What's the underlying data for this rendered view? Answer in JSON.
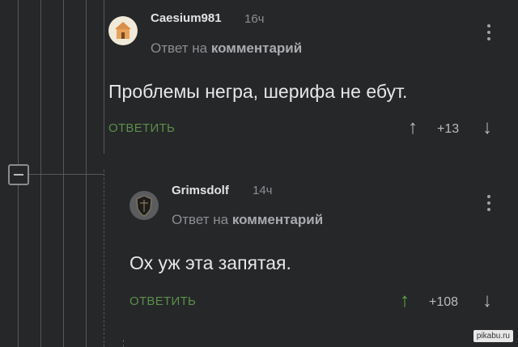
{
  "thread": {
    "collapse_icon": "minus-icon"
  },
  "comments": [
    {
      "author": "Caesium981",
      "time": "16ч",
      "reply_prefix": "Ответ на",
      "reply_target": "комментарий",
      "text": "Проблемы негра, шерифа не ебут.",
      "reply_label": "ОТВЕТИТЬ",
      "rating": "+13",
      "avatar_icon": "house-avatar-icon",
      "upvote_color": "#b9bbbf"
    },
    {
      "author": "Grimsdolf",
      "time": "14ч",
      "reply_prefix": "Ответ на",
      "reply_target": "комментарий",
      "text": "Ох уж эта запятая.",
      "reply_label": "ОТВЕТИТЬ",
      "rating": "+108",
      "avatar_icon": "shield-avatar-icon",
      "upvote_color": "#5fa844"
    }
  ],
  "watermark": "pikabu.ru"
}
